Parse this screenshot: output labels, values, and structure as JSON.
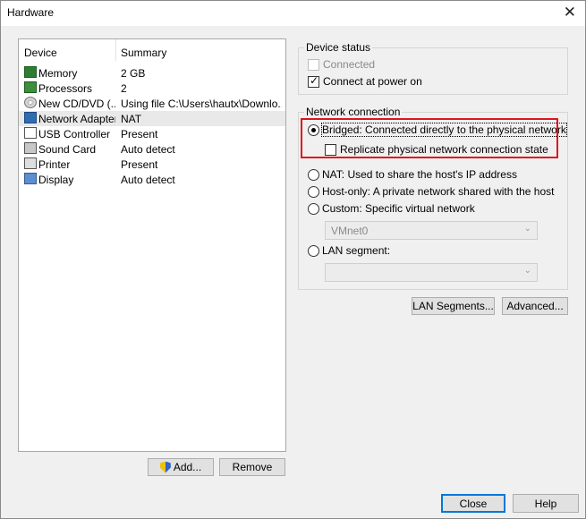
{
  "window": {
    "title": "Hardware",
    "close_glyph": "✕"
  },
  "device_list": {
    "header": {
      "device": "Device",
      "summary": "Summary"
    },
    "rows": [
      {
        "icon": "memory-icon",
        "device": "Memory",
        "summary": "2 GB"
      },
      {
        "icon": "processor-icon",
        "device": "Processors",
        "summary": "2"
      },
      {
        "icon": "cd-dvd-icon",
        "device": "New CD/DVD (...",
        "summary": "Using file C:\\Users\\hautx\\Downlo..."
      },
      {
        "icon": "network-adapter-icon",
        "device": "Network Adapter",
        "summary": "NAT",
        "selected": true
      },
      {
        "icon": "usb-controller-icon",
        "device": "USB Controller",
        "summary": "Present"
      },
      {
        "icon": "sound-card-icon",
        "device": "Sound Card",
        "summary": "Auto detect"
      },
      {
        "icon": "printer-icon",
        "device": "Printer",
        "summary": "Present"
      },
      {
        "icon": "display-icon",
        "device": "Display",
        "summary": "Auto detect"
      }
    ]
  },
  "buttons": {
    "add": "Add...",
    "remove": "Remove",
    "lan_segments": "LAN Segments...",
    "advanced": "Advanced...",
    "close": "Close",
    "help": "Help"
  },
  "device_status": {
    "legend": "Device status",
    "connected": {
      "label": "Connected",
      "checked": false,
      "disabled": true
    },
    "connect_at_power_on": {
      "label": "Connect at power on",
      "checked": true
    }
  },
  "network_connection": {
    "legend": "Network connection",
    "bridged": {
      "label": "Bridged: Connected directly to the physical network",
      "checked": true
    },
    "replicate": {
      "label": "Replicate physical network connection state",
      "checked": false
    },
    "nat": {
      "label": "NAT: Used to share the host's IP address"
    },
    "host_only": {
      "label": "Host-only: A private network shared with the host"
    },
    "custom": {
      "label": "Custom: Specific virtual network"
    },
    "custom_value": "VMnet0",
    "lan_segment": {
      "label": "LAN segment:"
    },
    "lan_segment_value": ""
  },
  "colors": {
    "highlight": "#e0141e",
    "default_button_border": "#0078d7"
  }
}
